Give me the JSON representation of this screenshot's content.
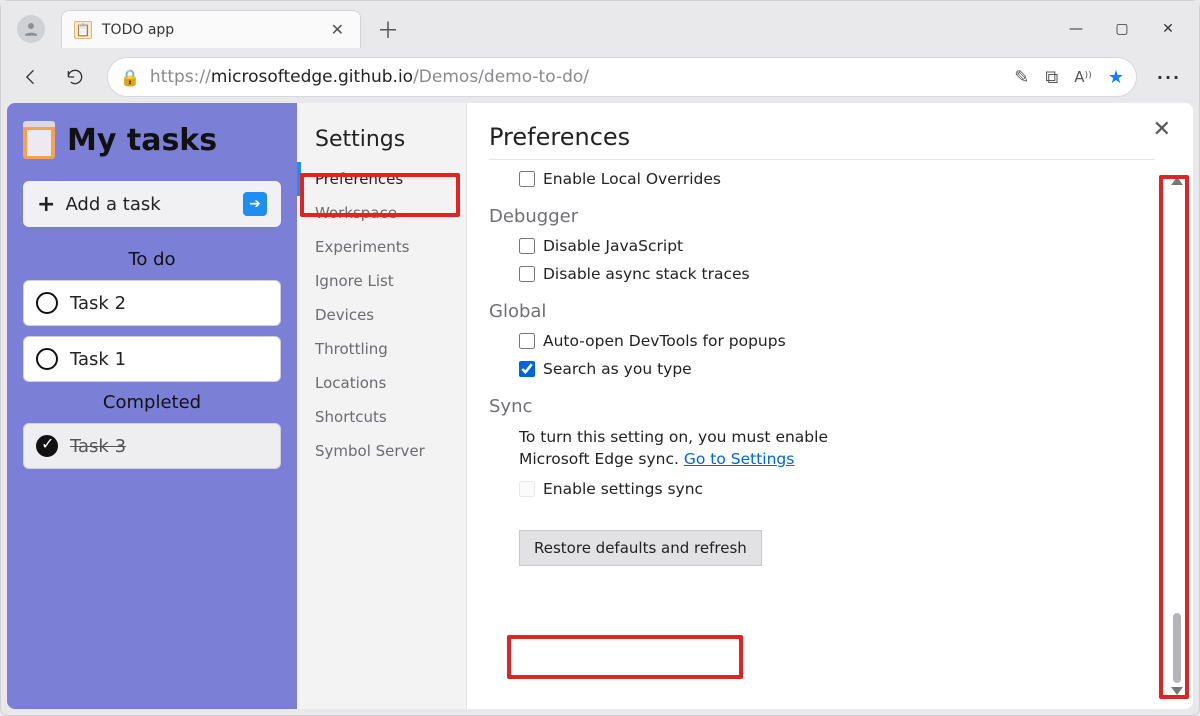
{
  "browser": {
    "tab_title": "TODO app",
    "url_host": "microsoftedge.github.io",
    "url_path": "/Demos/demo-to-do/",
    "url_prefix": "https://"
  },
  "app": {
    "title": "My tasks",
    "add_task_label": "Add a task",
    "sections": {
      "todo": "To do",
      "completed": "Completed"
    },
    "tasks_todo": [
      "Task 2",
      "Task 1"
    ],
    "tasks_done": [
      "Task 3"
    ]
  },
  "settings": {
    "title": "Settings",
    "items": [
      "Preferences",
      "Workspace",
      "Experiments",
      "Ignore List",
      "Devices",
      "Throttling",
      "Locations",
      "Shortcuts",
      "Symbol Server"
    ],
    "active_index": 0
  },
  "prefs": {
    "title": "Preferences",
    "overrides_label": "Enable Local Overrides",
    "debugger_heading": "Debugger",
    "disable_js_label": "Disable JavaScript",
    "disable_async_label": "Disable async stack traces",
    "global_heading": "Global",
    "auto_open_label": "Auto-open DevTools for popups",
    "search_type_label": "Search as you type",
    "sync_heading": "Sync",
    "sync_msg_pre": "To turn this setting on, you must enable Microsoft Edge sync. ",
    "sync_link": "Go to Settings",
    "enable_sync_label": "Enable settings sync",
    "restore_label": "Restore defaults and refresh",
    "checked": {
      "search_type": true
    }
  }
}
